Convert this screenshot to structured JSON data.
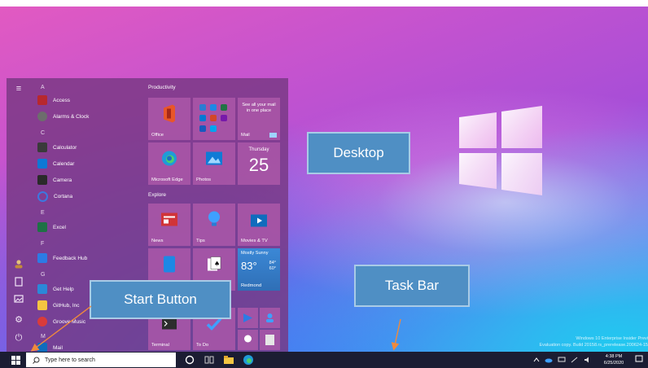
{
  "start_menu": {
    "letters": [
      "A",
      "C",
      "E",
      "F",
      "G",
      "M"
    ],
    "apps": [
      {
        "label": "Access",
        "icon": "access-icon",
        "color": "#b7282e"
      },
      {
        "label": "Alarms & Clock",
        "icon": "alarm-clock-icon",
        "color": "#5a5a5a"
      },
      {
        "label": "Calculator",
        "icon": "calculator-icon",
        "color": "#3a3a3a"
      },
      {
        "label": "Calendar",
        "icon": "calendar-icon",
        "color": "#0e78d5"
      },
      {
        "label": "Camera",
        "icon": "camera-icon",
        "color": "#2a2a2a"
      },
      {
        "label": "Cortana",
        "icon": "cortana-icon",
        "color": "#3c78e0"
      },
      {
        "label": "Excel",
        "icon": "excel-icon",
        "color": "#1e7145"
      },
      {
        "label": "Feedback Hub",
        "icon": "feedback-hub-icon",
        "color": "#2c7be5"
      },
      {
        "label": "Get Help",
        "icon": "get-help-icon",
        "color": "#2b88d8"
      },
      {
        "label": "GitHub, Inc",
        "icon": "folder-icon",
        "color": "#f4c542"
      },
      {
        "label": "Groove Music",
        "icon": "groove-music-icon",
        "color": "#d93b3b"
      },
      {
        "label": "Mail",
        "icon": "mail-icon",
        "color": "#0f6cbd"
      }
    ],
    "groups": {
      "productivity": "Productivity",
      "explore": "Explore"
    },
    "tiles": {
      "office": "Office",
      "mail": "Mail",
      "mail_promo": "See all your mail in one place",
      "edge": "Microsoft Edge",
      "photos": "Photos",
      "calendar_day": "Thursday",
      "calendar_date": "25",
      "news": "News",
      "tips": "Tips",
      "movies": "Movies & TV",
      "weather_cond": "Mostly Sunny",
      "weather_temp": "83°",
      "weather_hi": "84°",
      "weather_lo": "60°",
      "weather_city": "Redmond",
      "terminal": "Terminal",
      "todo": "To Do"
    }
  },
  "taskbar": {
    "search_placeholder": "Type here to search",
    "time": "4:38 PM",
    "date": "6/25/2020"
  },
  "watermark": {
    "line1": "Windows 10 Enterprise Insider Previ",
    "line2": "Evaluation copy. Build 20158.rs_prerelease.200624-15"
  },
  "callouts": {
    "desktop": "Desktop",
    "start_button": "Start Button",
    "task_bar": "Task Bar"
  },
  "colors": {
    "callout_fill": "#4f8fc4",
    "taskbar": "#1b1d33",
    "start_menu": "#7a3a84",
    "arrow": "#f08a3c"
  }
}
